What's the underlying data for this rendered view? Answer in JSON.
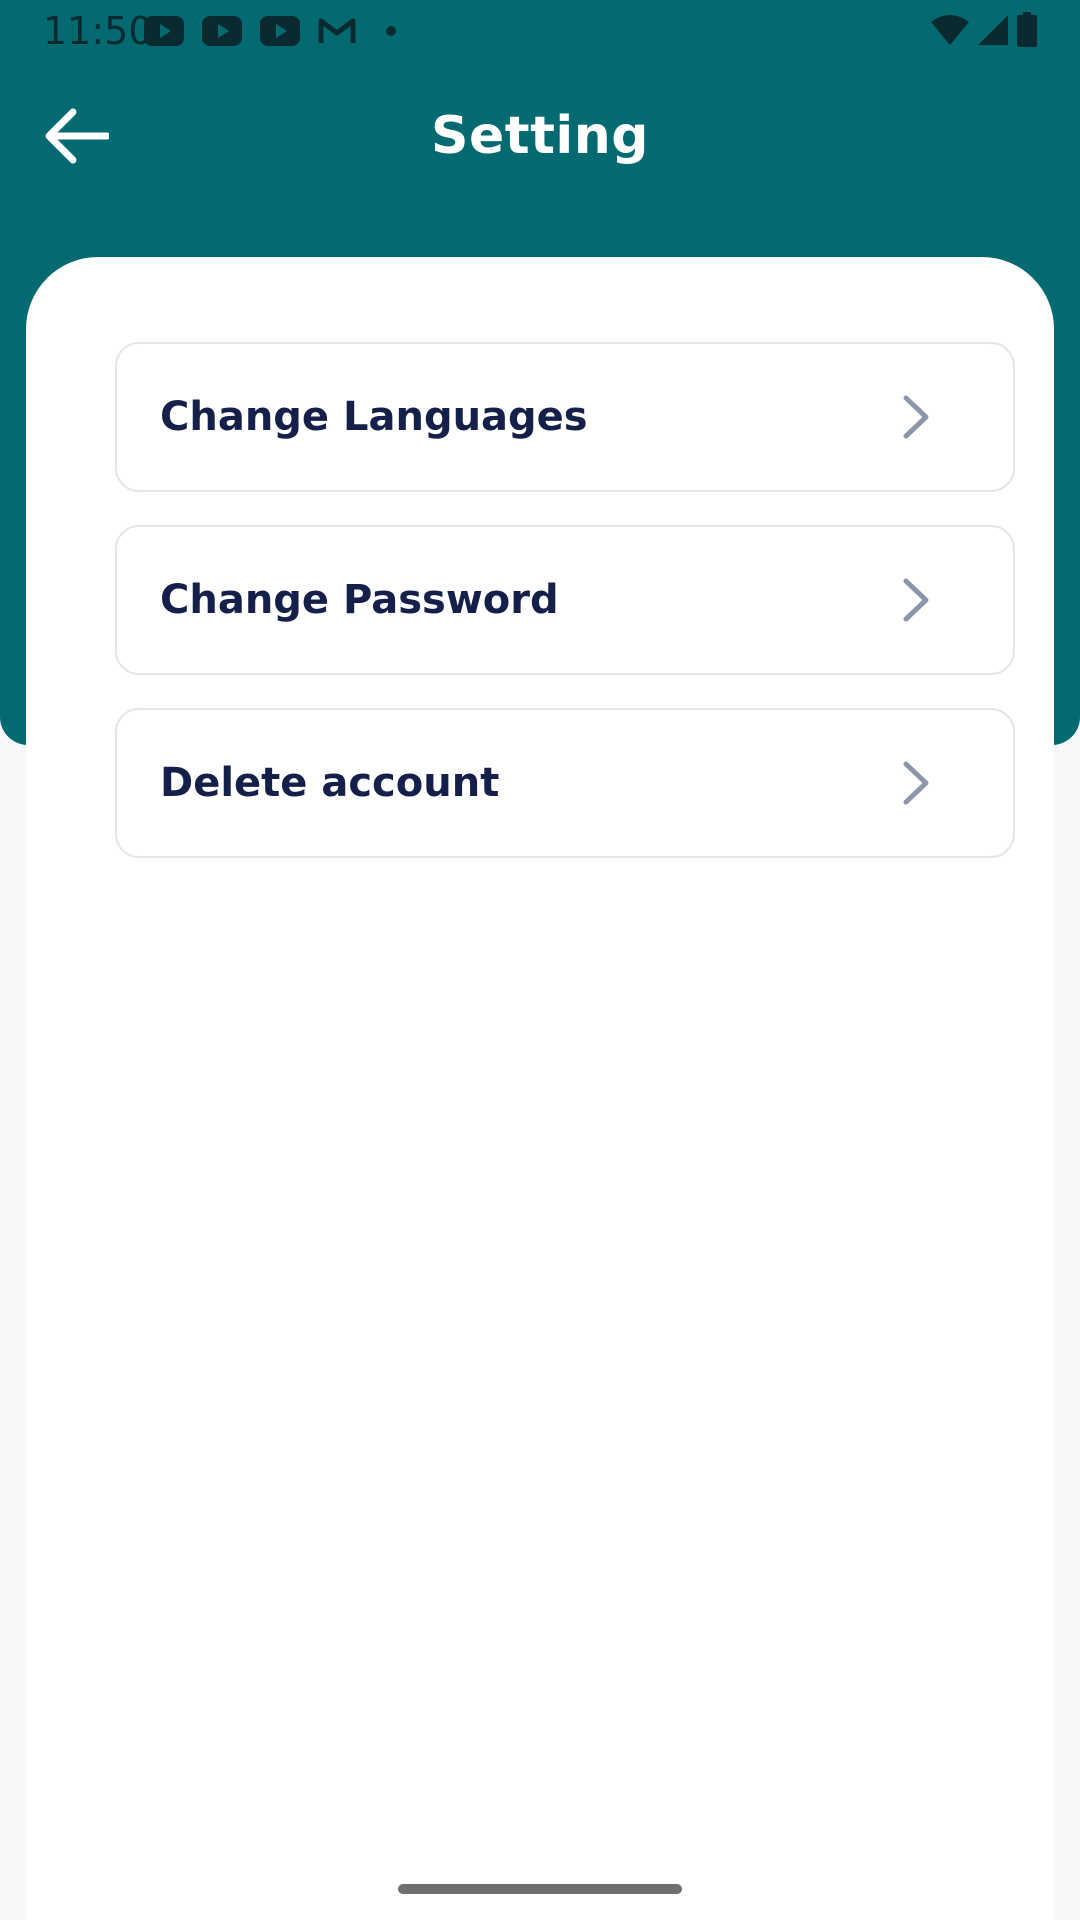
{
  "status_bar": {
    "time": "11:50",
    "notification_icons": [
      "youtube-icon",
      "youtube-icon",
      "youtube-icon",
      "gmail-icon",
      "dot-icon"
    ],
    "system_icons": [
      "wifi-icon",
      "cellular-signal-icon",
      "battery-icon"
    ]
  },
  "header": {
    "title": "Setting",
    "back_icon": "arrow-left-icon",
    "color": "#026a70"
  },
  "menu": {
    "items": [
      {
        "label": "Change Languages",
        "icon": "chevron-right-icon"
      },
      {
        "label": "Change Password",
        "icon": "chevron-right-icon"
      },
      {
        "label": "Delete account",
        "icon": "chevron-right-icon"
      }
    ]
  },
  "colors": {
    "primary": "#026a70",
    "label_text": "#14204a",
    "chevron": "#8c96ab",
    "item_border": "#e4e6ea"
  }
}
